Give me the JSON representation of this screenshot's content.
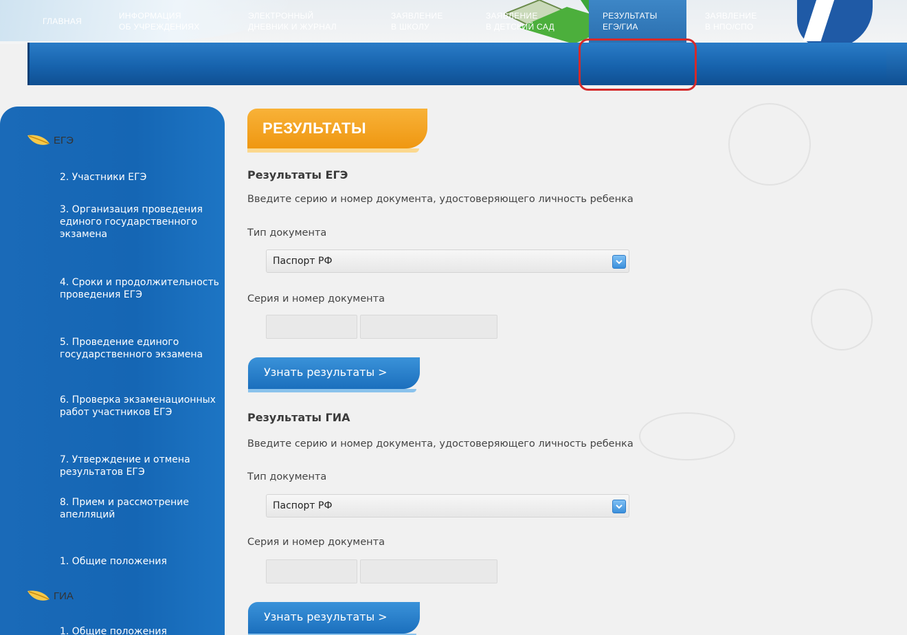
{
  "nav": {
    "items": [
      {
        "line1": "ГЛАВНАЯ",
        "line2": ""
      },
      {
        "line1": "ИНФОРМАЦИЯ",
        "line2": "ОБ УЧРЕЖДЕНИЯХ"
      },
      {
        "line1": "ЭЛЕКТРОННЫЙ",
        "line2": "ДНЕВНИК И ЖУРНАЛ"
      },
      {
        "line1": "ЗАЯВЛЕНИЕ",
        "line2": "В ШКОЛУ"
      },
      {
        "line1": "ЗАЯВЛЕНИЕ",
        "line2": "В ДЕТСКИЙ САД"
      },
      {
        "line1": "РЕЗУЛЬТАТЫ",
        "line2": "ЕГЭ/ГИА"
      },
      {
        "line1": "ЗАЯВЛЕНИЕ",
        "line2": "В НПО/СПО"
      }
    ]
  },
  "sidebar": {
    "section_ege": "ЕГЭ",
    "section_gia": "ГИА",
    "items": [
      "2. Участники ЕГЭ",
      "3. Организация проведения единого государственного экзамена",
      "4. Сроки и продолжительность проведения ЕГЭ",
      "5. Проведение единого государственного экзамена",
      "6. Проверка экзаменационных работ участников ЕГЭ",
      "7. Утверждение и отмена результатов ЕГЭ",
      "8. Прием и рассмотрение апелляций",
      "1. Общие положения",
      "1. Общие положения"
    ]
  },
  "main": {
    "tab_title": "РЕЗУЛЬТАТЫ",
    "ege": {
      "title": "Результаты ЕГЭ",
      "hint": "Введите серию и номер документа, удостоверяющего личность ребенка",
      "doc_type_label": "Тип документа",
      "doc_type_value": "Паспорт РФ",
      "series_label": "Серия и номер документа",
      "button": "Узнать результаты >"
    },
    "gia": {
      "title": "Результаты ГИА",
      "hint": "Введите серию и номер документа, удостоверяющего личность ребенка",
      "doc_type_label": "Тип документа",
      "doc_type_value": "Паспорт РФ",
      "series_label": "Серия и номер документа",
      "button": "Узнать результаты >"
    }
  },
  "colors": {
    "nav_blue": "#1763ad",
    "orange_tab": "#f5a623",
    "highlight_red": "#d42a2a"
  }
}
